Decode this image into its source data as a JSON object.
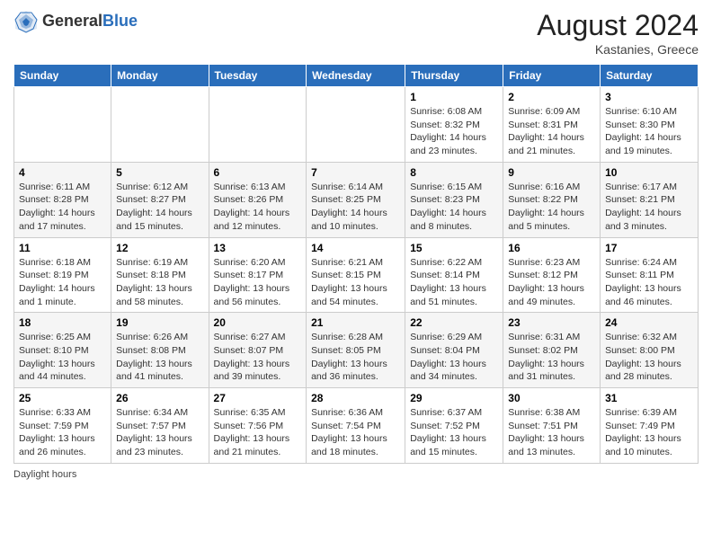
{
  "header": {
    "logo_general": "General",
    "logo_blue": "Blue",
    "month_year": "August 2024",
    "location": "Kastanies, Greece"
  },
  "footer": {
    "label": "Daylight hours"
  },
  "weekdays": [
    "Sunday",
    "Monday",
    "Tuesday",
    "Wednesday",
    "Thursday",
    "Friday",
    "Saturday"
  ],
  "weeks": [
    [
      {
        "day": "",
        "info": ""
      },
      {
        "day": "",
        "info": ""
      },
      {
        "day": "",
        "info": ""
      },
      {
        "day": "",
        "info": ""
      },
      {
        "day": "1",
        "info": "Sunrise: 6:08 AM\nSunset: 8:32 PM\nDaylight: 14 hours and 23 minutes."
      },
      {
        "day": "2",
        "info": "Sunrise: 6:09 AM\nSunset: 8:31 PM\nDaylight: 14 hours and 21 minutes."
      },
      {
        "day": "3",
        "info": "Sunrise: 6:10 AM\nSunset: 8:30 PM\nDaylight: 14 hours and 19 minutes."
      }
    ],
    [
      {
        "day": "4",
        "info": "Sunrise: 6:11 AM\nSunset: 8:28 PM\nDaylight: 14 hours and 17 minutes."
      },
      {
        "day": "5",
        "info": "Sunrise: 6:12 AM\nSunset: 8:27 PM\nDaylight: 14 hours and 15 minutes."
      },
      {
        "day": "6",
        "info": "Sunrise: 6:13 AM\nSunset: 8:26 PM\nDaylight: 14 hours and 12 minutes."
      },
      {
        "day": "7",
        "info": "Sunrise: 6:14 AM\nSunset: 8:25 PM\nDaylight: 14 hours and 10 minutes."
      },
      {
        "day": "8",
        "info": "Sunrise: 6:15 AM\nSunset: 8:23 PM\nDaylight: 14 hours and 8 minutes."
      },
      {
        "day": "9",
        "info": "Sunrise: 6:16 AM\nSunset: 8:22 PM\nDaylight: 14 hours and 5 minutes."
      },
      {
        "day": "10",
        "info": "Sunrise: 6:17 AM\nSunset: 8:21 PM\nDaylight: 14 hours and 3 minutes."
      }
    ],
    [
      {
        "day": "11",
        "info": "Sunrise: 6:18 AM\nSunset: 8:19 PM\nDaylight: 14 hours and 1 minute."
      },
      {
        "day": "12",
        "info": "Sunrise: 6:19 AM\nSunset: 8:18 PM\nDaylight: 13 hours and 58 minutes."
      },
      {
        "day": "13",
        "info": "Sunrise: 6:20 AM\nSunset: 8:17 PM\nDaylight: 13 hours and 56 minutes."
      },
      {
        "day": "14",
        "info": "Sunrise: 6:21 AM\nSunset: 8:15 PM\nDaylight: 13 hours and 54 minutes."
      },
      {
        "day": "15",
        "info": "Sunrise: 6:22 AM\nSunset: 8:14 PM\nDaylight: 13 hours and 51 minutes."
      },
      {
        "day": "16",
        "info": "Sunrise: 6:23 AM\nSunset: 8:12 PM\nDaylight: 13 hours and 49 minutes."
      },
      {
        "day": "17",
        "info": "Sunrise: 6:24 AM\nSunset: 8:11 PM\nDaylight: 13 hours and 46 minutes."
      }
    ],
    [
      {
        "day": "18",
        "info": "Sunrise: 6:25 AM\nSunset: 8:10 PM\nDaylight: 13 hours and 44 minutes."
      },
      {
        "day": "19",
        "info": "Sunrise: 6:26 AM\nSunset: 8:08 PM\nDaylight: 13 hours and 41 minutes."
      },
      {
        "day": "20",
        "info": "Sunrise: 6:27 AM\nSunset: 8:07 PM\nDaylight: 13 hours and 39 minutes."
      },
      {
        "day": "21",
        "info": "Sunrise: 6:28 AM\nSunset: 8:05 PM\nDaylight: 13 hours and 36 minutes."
      },
      {
        "day": "22",
        "info": "Sunrise: 6:29 AM\nSunset: 8:04 PM\nDaylight: 13 hours and 34 minutes."
      },
      {
        "day": "23",
        "info": "Sunrise: 6:31 AM\nSunset: 8:02 PM\nDaylight: 13 hours and 31 minutes."
      },
      {
        "day": "24",
        "info": "Sunrise: 6:32 AM\nSunset: 8:00 PM\nDaylight: 13 hours and 28 minutes."
      }
    ],
    [
      {
        "day": "25",
        "info": "Sunrise: 6:33 AM\nSunset: 7:59 PM\nDaylight: 13 hours and 26 minutes."
      },
      {
        "day": "26",
        "info": "Sunrise: 6:34 AM\nSunset: 7:57 PM\nDaylight: 13 hours and 23 minutes."
      },
      {
        "day": "27",
        "info": "Sunrise: 6:35 AM\nSunset: 7:56 PM\nDaylight: 13 hours and 21 minutes."
      },
      {
        "day": "28",
        "info": "Sunrise: 6:36 AM\nSunset: 7:54 PM\nDaylight: 13 hours and 18 minutes."
      },
      {
        "day": "29",
        "info": "Sunrise: 6:37 AM\nSunset: 7:52 PM\nDaylight: 13 hours and 15 minutes."
      },
      {
        "day": "30",
        "info": "Sunrise: 6:38 AM\nSunset: 7:51 PM\nDaylight: 13 hours and 13 minutes."
      },
      {
        "day": "31",
        "info": "Sunrise: 6:39 AM\nSunset: 7:49 PM\nDaylight: 13 hours and 10 minutes."
      }
    ]
  ]
}
